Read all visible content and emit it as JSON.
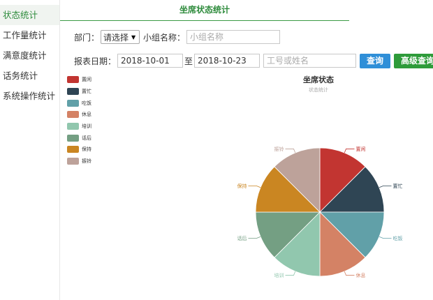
{
  "sidebar": {
    "items": [
      {
        "label": "状态统计",
        "active": true
      },
      {
        "label": "工作量统计",
        "active": false
      },
      {
        "label": "满意度统计",
        "active": false
      },
      {
        "label": "话务统计",
        "active": false
      },
      {
        "label": "系统操作统计",
        "active": false
      }
    ]
  },
  "page_title": "坐席状态统计",
  "filters": {
    "dept_label": "部门：",
    "dept_value": "请选择",
    "group_label": "小组名称：",
    "group_placeholder": "小组名称",
    "date_label": "报表日期：",
    "date_start": "2018-10-01",
    "date_sep": "至",
    "date_end": "2018-10-23",
    "agent_placeholder": "工号或姓名",
    "query_button": "查询",
    "advanced_button": "高级查询"
  },
  "chart_data": {
    "type": "pie",
    "title": "坐席状态",
    "subtitle": "状态统计",
    "legend_position": "left",
    "slices": [
      {
        "name": "置闲",
        "value": 1,
        "color": "#c23531"
      },
      {
        "name": "置忙",
        "value": 1,
        "color": "#2f4554"
      },
      {
        "name": "吃饭",
        "value": 1,
        "color": "#61a0a8"
      },
      {
        "name": "休息",
        "value": 1,
        "color": "#d48265"
      },
      {
        "name": "培训",
        "value": 1,
        "color": "#91c7ae"
      },
      {
        "name": "话后",
        "value": 1,
        "color": "#749f83"
      },
      {
        "name": "保持",
        "value": 1,
        "color": "#ca8622"
      },
      {
        "name": "振铃",
        "value": 1,
        "color": "#bda29a"
      }
    ]
  }
}
